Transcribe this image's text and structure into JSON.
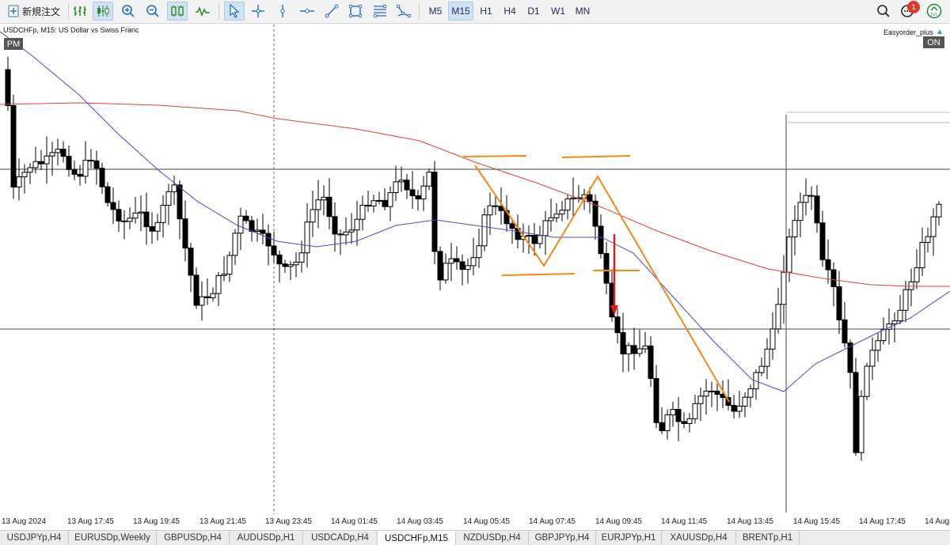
{
  "toolbar": {
    "new_order_label": "新規注文",
    "timeframes": [
      "M5",
      "M15",
      "H1",
      "H4",
      "D1",
      "W1",
      "MN"
    ],
    "active_timeframe": "M15",
    "notification_count": "1"
  },
  "chart": {
    "title": "USDCHFp, M15:  US Dollar vs Swiss Franc",
    "pm_label": "PM",
    "ea_name": "Easyorder_plus",
    "ea_status": "ON",
    "time_labels": [
      "13 Aug 2024",
      "13 Aug 17:45",
      "13 Aug 19:45",
      "13 Aug 21:45",
      "13 Aug 23:45",
      "14 Aug 01:45",
      "14 Aug 03:45",
      "14 Aug 05:45",
      "14 Aug 07:45",
      "14 Aug 09:45",
      "14 Aug 11:45",
      "14 Aug 13:45",
      "14 Aug 15:45",
      "14 Aug 17:45",
      "14 Aug"
    ],
    "colors": {
      "ma_fast": "#4a4ad0",
      "ma_slow": "#e04040",
      "annotation": "#f08a1c",
      "arrow": "#e01818",
      "bear_candle": "#000000",
      "bull_candle": "#ffffff"
    }
  },
  "tabs": [
    "USDJPYp,H4",
    "EURUSDp,Weekly",
    "GBPUSDp,H4",
    "AUDUSDp,H1",
    "USDCADp,H4",
    "USDCHFp,M15",
    "NZDUSDp,H4",
    "GBPJPYp,H4",
    "EURJPYp,H1",
    "XAUUSDp,H4",
    "BRENTp,H1"
  ],
  "active_tab": "USDCHFp,M15"
}
